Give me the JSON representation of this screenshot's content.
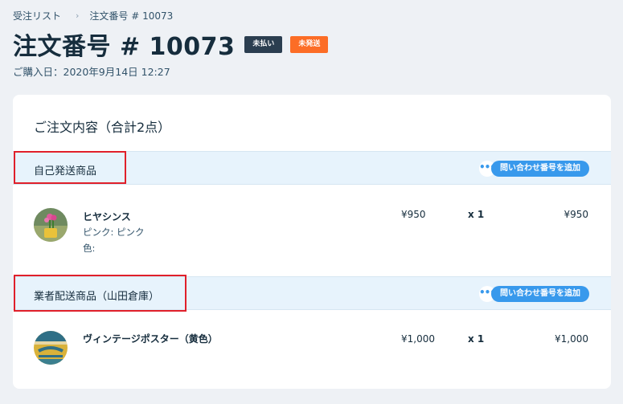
{
  "breadcrumb": {
    "parent": "受注リスト",
    "separator": "›",
    "current": "注文番号 # 10073"
  },
  "order": {
    "title": "注文番号 # 10073",
    "payment_badge": "未払い",
    "shipping_badge": "未発送",
    "purchase_date": "ご購入日：2020年9月14日 12:27"
  },
  "colors": {
    "accent": "#3899ec",
    "unpaid_badge": "#2b3e50",
    "unshipped_badge": "#fc6d26",
    "highlight_border": "#e0202a",
    "section_bg": "#e7f3fc"
  },
  "card": {
    "title": "ご注文内容（合計2点）"
  },
  "sections": [
    {
      "label": "自己発送商品",
      "more_icon": "more-horizontal-icon",
      "more_text": "•••",
      "add_tracking_label": "問い合わせ番号を追加",
      "items": [
        {
          "name": "ヒヤシンス",
          "option_line1": "ピンク: ピンク",
          "option_line2": "色:",
          "price": "¥950",
          "quantity": "x 1",
          "total": "¥950"
        }
      ]
    },
    {
      "label": "業者配送商品（山田倉庫）",
      "more_icon": "more-horizontal-icon",
      "more_text": "•••",
      "add_tracking_label": "問い合わせ番号を追加",
      "items": [
        {
          "name": "ヴィンテージポスター（黄色）",
          "price": "¥1,000",
          "quantity": "x 1",
          "total": "¥1,000"
        }
      ]
    }
  ]
}
